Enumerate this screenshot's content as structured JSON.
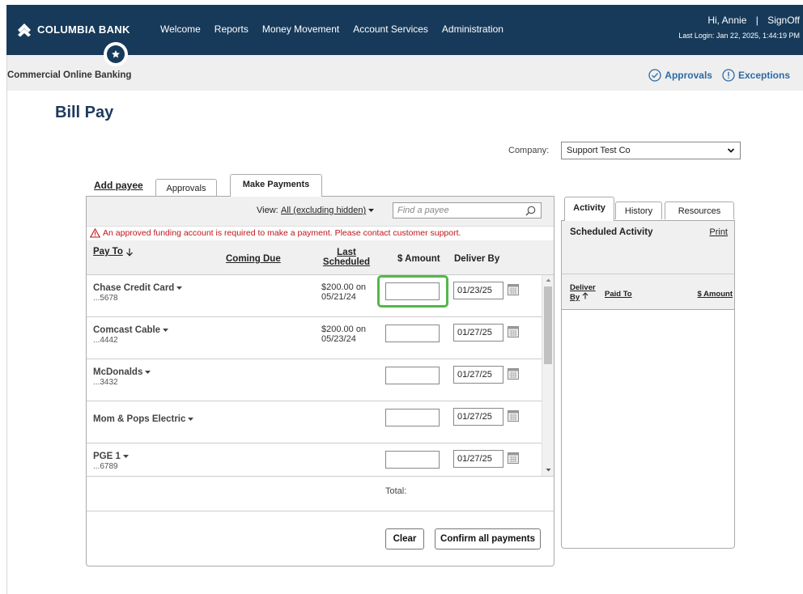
{
  "header": {
    "brand": "COLUMBIA BANK",
    "nav": [
      "Welcome",
      "Reports",
      "Money Movement",
      "Account Services",
      "Administration"
    ],
    "greeting": "Hi, Annie",
    "separator": "|",
    "signoff": "SignOff",
    "last_login": "Last Login: Jan 22, 2025, 1:44:19 PM"
  },
  "subheader": {
    "title": "Commercial Online Banking",
    "approvals": "Approvals",
    "exceptions": "Exceptions"
  },
  "page": {
    "title": "Bill Pay",
    "company_label": "Company:",
    "company_value": "Support Test Co"
  },
  "tabs": {
    "add_payee": "Add payee",
    "approvals": "Approvals",
    "make_payments": "Make Payments"
  },
  "viewbar": {
    "view_label": "View:",
    "view_value": "All (excluding hidden)",
    "find_placeholder": "Find a payee"
  },
  "warning": "An approved funding account is required to make a payment. Please contact customer support.",
  "columns": {
    "pay_to": "Pay To",
    "coming_due": "Coming Due",
    "last_line1": "Last",
    "last_line2": "Scheduled",
    "amount": "$ Amount",
    "deliver_by": "Deliver By"
  },
  "payees": [
    {
      "name": "Chase Credit Card",
      "account": "...5678",
      "last_amount": "$200.00 on",
      "last_date": "05/21/24",
      "deliver": "01/23/25"
    },
    {
      "name": "Comcast Cable",
      "account": "...4442",
      "last_amount": "$200.00 on",
      "last_date": "05/23/24",
      "deliver": "01/27/25"
    },
    {
      "name": "McDonalds",
      "account": "...3432",
      "last_amount": "",
      "last_date": "",
      "deliver": "01/27/25"
    },
    {
      "name": "Mom & Pops Electric",
      "account": "",
      "last_amount": "",
      "last_date": "",
      "deliver": "01/27/25"
    },
    {
      "name": "PGE 1",
      "account": "...6789",
      "last_amount": "",
      "last_date": "",
      "deliver": "01/27/25"
    }
  ],
  "footer": {
    "total_label": "Total:",
    "clear": "Clear",
    "confirm": "Confirm all payments"
  },
  "right_panel": {
    "tabs": [
      "Activity",
      "History",
      "Resources"
    ],
    "scheduled_title": "Scheduled Activity",
    "print": "Print",
    "deliver_line1": "Deliver",
    "deliver_line2": "By",
    "paid_to": "Paid To",
    "amount": "$ Amount"
  },
  "colors": {
    "nav_bg": "#173a5a",
    "link": "#2d6aa3",
    "warning": "#c0141a",
    "focus": "#52b848"
  }
}
